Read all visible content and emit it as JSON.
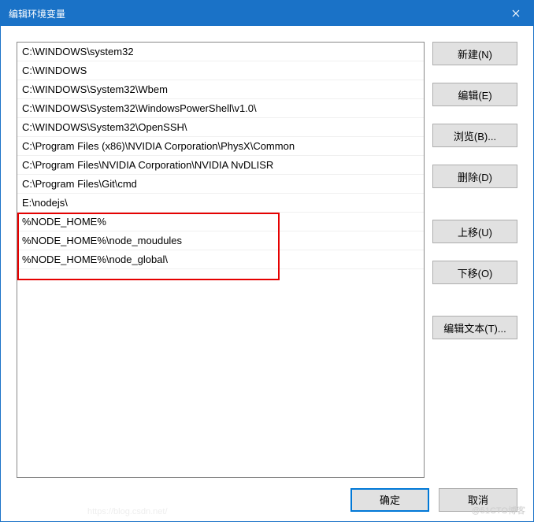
{
  "title": "编辑环境变量",
  "list_items": [
    "C:\\WINDOWS\\system32",
    "C:\\WINDOWS",
    "C:\\WINDOWS\\System32\\Wbem",
    "C:\\WINDOWS\\System32\\WindowsPowerShell\\v1.0\\",
    "C:\\WINDOWS\\System32\\OpenSSH\\",
    "C:\\Program Files (x86)\\NVIDIA Corporation\\PhysX\\Common",
    "C:\\Program Files\\NVIDIA Corporation\\NVIDIA NvDLISR",
    "C:\\Program Files\\Git\\cmd",
    "E:\\nodejs\\",
    "%NODE_HOME%",
    "%NODE_HOME%\\node_moudules",
    "%NODE_HOME%\\node_global\\"
  ],
  "buttons": {
    "new": "新建(N)",
    "edit": "编辑(E)",
    "browse": "浏览(B)...",
    "delete": "删除(D)",
    "move_up": "上移(U)",
    "move_down": "下移(O)",
    "edit_text": "编辑文本(T)...",
    "ok": "确定",
    "cancel": "取消"
  },
  "watermark_right": "@51CTO博客",
  "watermark_left": "https://blog.csdn.net/"
}
